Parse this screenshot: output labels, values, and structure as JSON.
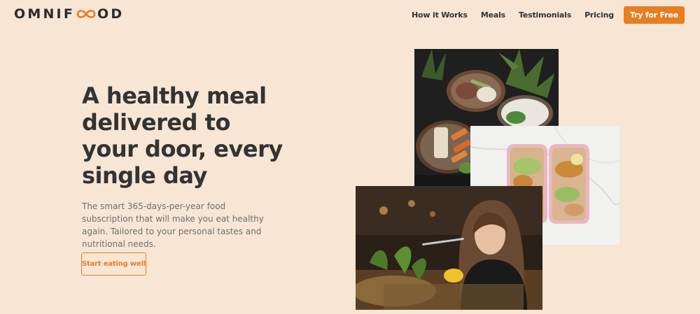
{
  "brand": {
    "name_before": "OMNIF",
    "name_after": "OD"
  },
  "nav": {
    "links": [
      "How it Works",
      "Meals",
      "Testimonials",
      "Pricing"
    ],
    "cta": "Try for Free"
  },
  "hero": {
    "title": "A healthy meal delivered to your door, every single day",
    "description": "The smart 365-days-per-year food subscription that will make you eat healthy again. Tailored to your personal tastes and nutritional needs.",
    "button": "Start eating well"
  },
  "colors": {
    "accent": "#e67e22",
    "background": "#f7e6d4",
    "text": "#333333"
  }
}
